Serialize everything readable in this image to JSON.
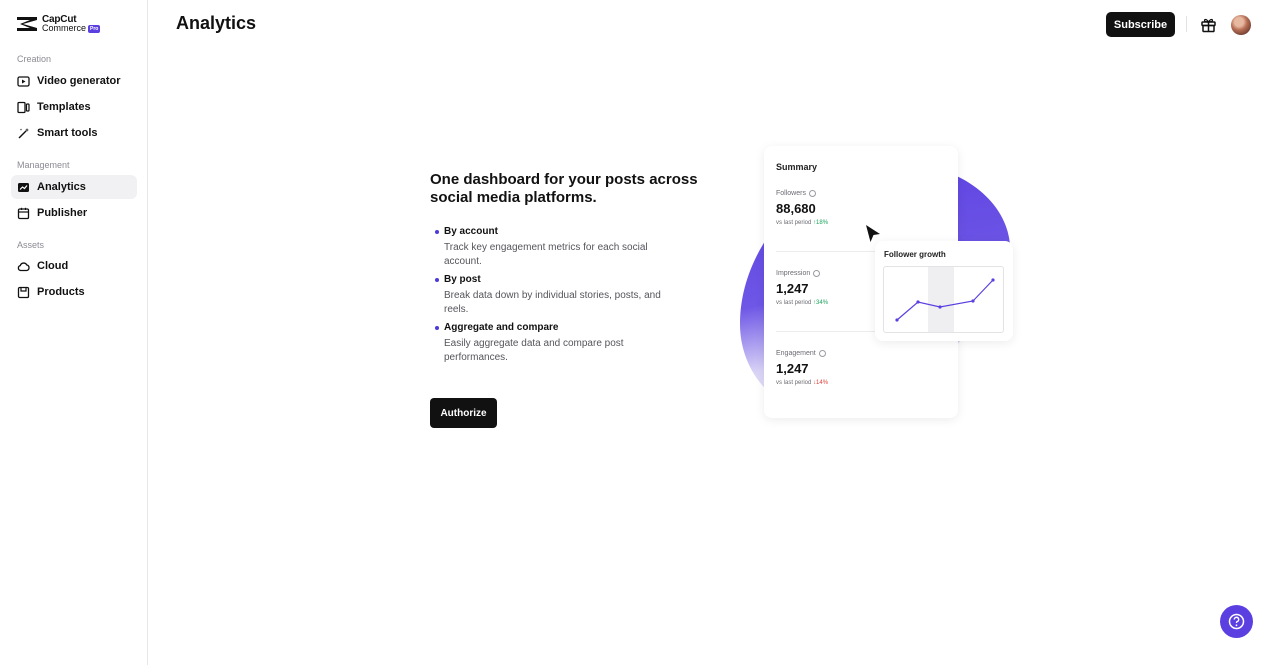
{
  "brand": {
    "line1": "CapCut",
    "line2": "Commerce",
    "badge": "Pro"
  },
  "sidebar": {
    "sections": [
      {
        "label": "Creation"
      },
      {
        "label": "Management"
      },
      {
        "label": "Assets"
      }
    ],
    "items": [
      {
        "label": "Video generator",
        "icon": "video-generator-icon"
      },
      {
        "label": "Templates",
        "icon": "templates-icon"
      },
      {
        "label": "Smart tools",
        "icon": "magic-wand-icon"
      },
      {
        "label": "Analytics",
        "icon": "analytics-icon",
        "active": true
      },
      {
        "label": "Publisher",
        "icon": "calendar-icon"
      },
      {
        "label": "Cloud",
        "icon": "cloud-icon"
      },
      {
        "label": "Products",
        "icon": "product-icon"
      }
    ]
  },
  "header": {
    "title": "Analytics",
    "subscribe_label": "Subscribe"
  },
  "main": {
    "headline": "One dashboard for your posts across social media platforms.",
    "features": [
      {
        "title": "By account",
        "desc": "Track key engagement metrics for each social account."
      },
      {
        "title": "By post",
        "desc": "Break data down by individual stories, posts, and reels."
      },
      {
        "title": "Aggregate and compare",
        "desc": "Easily aggregate data and compare post performances."
      }
    ],
    "authorize_label": "Authorize"
  },
  "illustration": {
    "summary_title": "Summary",
    "metrics": [
      {
        "label": "Followers",
        "value": "88,680",
        "foot": "vs last period",
        "change": "↑18%",
        "trend": "up"
      },
      {
        "label": "Impression",
        "value": "1,247",
        "foot": "vs last period",
        "change": "↑34%",
        "trend": "up"
      },
      {
        "label": "Engagement",
        "value": "1,247",
        "foot": "vs last period",
        "change": "↓14%",
        "trend": "down"
      }
    ],
    "growth_title": "Follower growth",
    "accent_color": "#5b3fe0"
  },
  "colors": {
    "accent": "#5b3fe0",
    "button_dark": "#111111",
    "up": "#1aa35b",
    "down": "#e0403a"
  }
}
